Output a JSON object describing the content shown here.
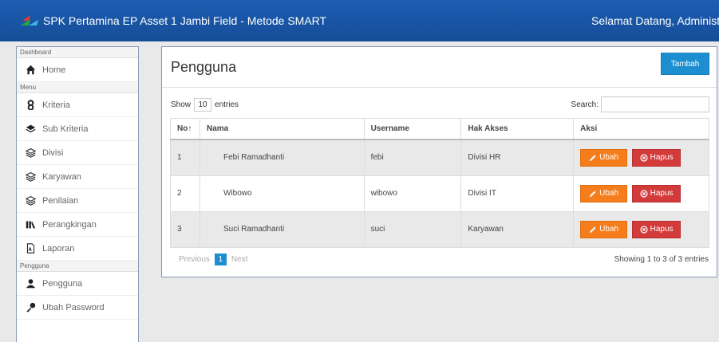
{
  "navbar": {
    "title": "SPK Pertamina EP Asset 1 Jambi Field - Metode SMART",
    "welcome": "Selamat Datang, Administrato"
  },
  "sidebar": {
    "sections": [
      {
        "header": "Dashboard",
        "items": [
          {
            "label": "Home",
            "icon": "home-icon"
          }
        ]
      },
      {
        "header": "Menu",
        "items": [
          {
            "label": "Kriteria",
            "icon": "kriteria-icon"
          },
          {
            "label": "Sub Kriteria",
            "icon": "layers-icon"
          },
          {
            "label": "Divisi",
            "icon": "stack-icon"
          },
          {
            "label": "Karyawan",
            "icon": "stack-icon"
          },
          {
            "label": "Penilaian",
            "icon": "stack-icon"
          },
          {
            "label": "Perangkingan",
            "icon": "ranking-icon"
          },
          {
            "label": "Laporan",
            "icon": "report-icon"
          }
        ]
      },
      {
        "header": "Pengguna",
        "items": [
          {
            "label": "Pengguna",
            "icon": "user-icon"
          },
          {
            "label": "Ubah Password",
            "icon": "key-icon"
          }
        ]
      }
    ]
  },
  "main": {
    "title": "Pengguna",
    "add_button": "Tambah",
    "show_label": "Show",
    "entries_value": "10",
    "entries_label": "entries",
    "search_label": "Search:",
    "search_value": "",
    "columns": [
      "No",
      "Nama",
      "Username",
      "Hak Akses",
      "Aksi"
    ],
    "sort_indicator": "↑",
    "rows": [
      {
        "no": "1",
        "nama": "Febi Ramadhanti",
        "username": "febi",
        "hak_akses": "Divisi HR"
      },
      {
        "no": "2",
        "nama": "Wibowo",
        "username": "wibowo",
        "hak_akses": "Divisi IT"
      },
      {
        "no": "3",
        "nama": "Suci Ramadhanti",
        "username": "suci",
        "hak_akses": "Karyawan"
      }
    ],
    "edit_label": "Ubah",
    "delete_label": "Hapus",
    "pager": {
      "previous": "Previous",
      "current": "1",
      "next": "Next"
    },
    "showing": "Showing 1 to 3 of 3 entries"
  },
  "colors": {
    "navbar": "#1a57a9",
    "primary": "#1d8fd1",
    "edit": "#f57d1b",
    "delete": "#d33a3a"
  }
}
